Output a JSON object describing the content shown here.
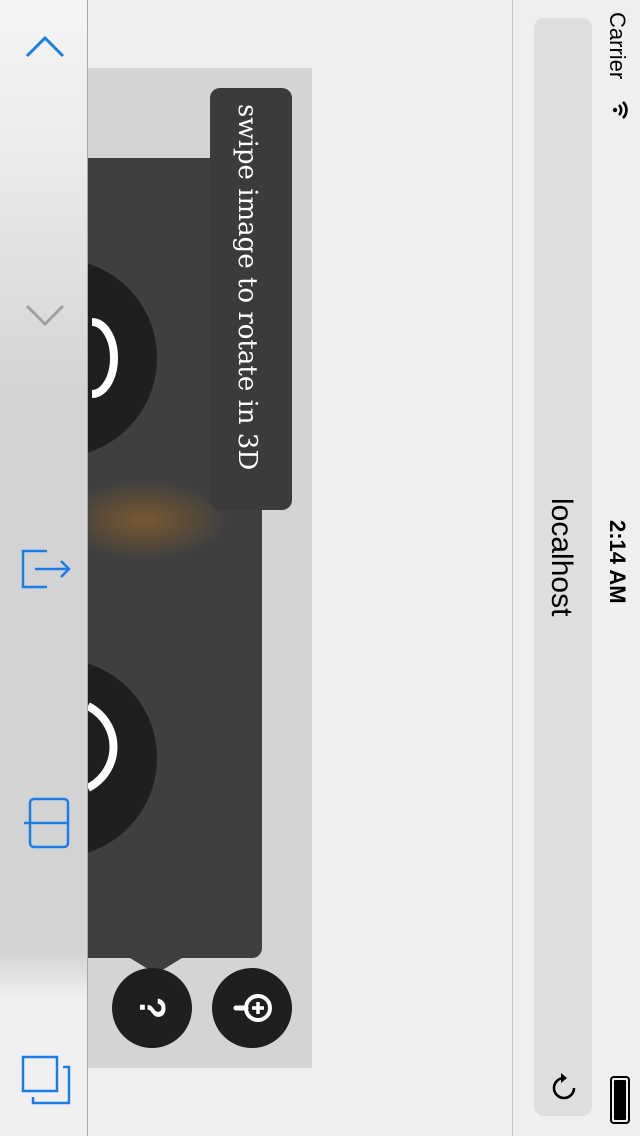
{
  "status": {
    "carrier": "Carrier",
    "time": "2:14 AM"
  },
  "address_bar": {
    "host": "localhost"
  },
  "viewer": {
    "tooltip": "swipe image to rotate in 3D",
    "help_label": "?"
  },
  "toolbar": {
    "icons": [
      "chevron-up-icon",
      "chevron-down-icon",
      "share-icon",
      "bookmarks-icon",
      "tabs-icon"
    ]
  },
  "colors": {
    "accent": "#1a7ee6",
    "panel": "#3f3f3f",
    "button": "#1f1f1f"
  }
}
